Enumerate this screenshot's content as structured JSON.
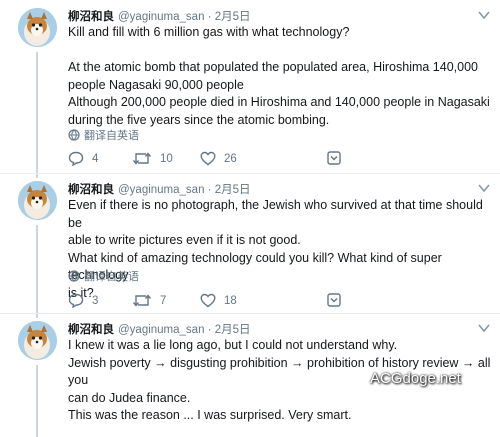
{
  "tweets": [
    {
      "author_name": "柳沼和良",
      "handle_date": "@yaginuma_san · 2月5日",
      "lines": [
        "Kill and fill with 6 million gas with what technology?",
        "",
        "At the atomic bomb that populated the populated area, Hiroshima 140,000",
        "people Nagasaki 90,000 people",
        "Although 200,000 people died in Hiroshima and 140,000 people in Nagasaki",
        "during the five years since the atomic bombing."
      ],
      "translate": "翻译自英语",
      "replies": "4",
      "retweets": "10",
      "likes": "26"
    },
    {
      "author_name": "柳沼和良",
      "handle_date": "@yaginuma_san · 2月5日",
      "lines": [
        "Even if there is no photograph, the Jewish who survived at that time should be",
        "able to write pictures even if it is not good.",
        "What kind of amazing technology could you kill? What kind of super technology",
        "is it?"
      ],
      "translate": "翻译自英语",
      "replies": "3",
      "retweets": "7",
      "likes": "18"
    },
    {
      "author_name": "柳沼和良",
      "handle_date": "@yaginuma_san · 2月5日",
      "lines": [
        "I knew it was a lie long ago, but I could not understand why.",
        "Jewish poverty → disgusting prohibition → prohibition of history review → all you",
        "can do Judea finance.",
        "This was the reason ... I was surprised. Very smart."
      ]
    }
  ],
  "watermark": "ACGdoge.net",
  "colors": {
    "text": "#14171a",
    "muted": "#657786",
    "divider": "#e6ecf0",
    "accent": "#1da1f2"
  }
}
